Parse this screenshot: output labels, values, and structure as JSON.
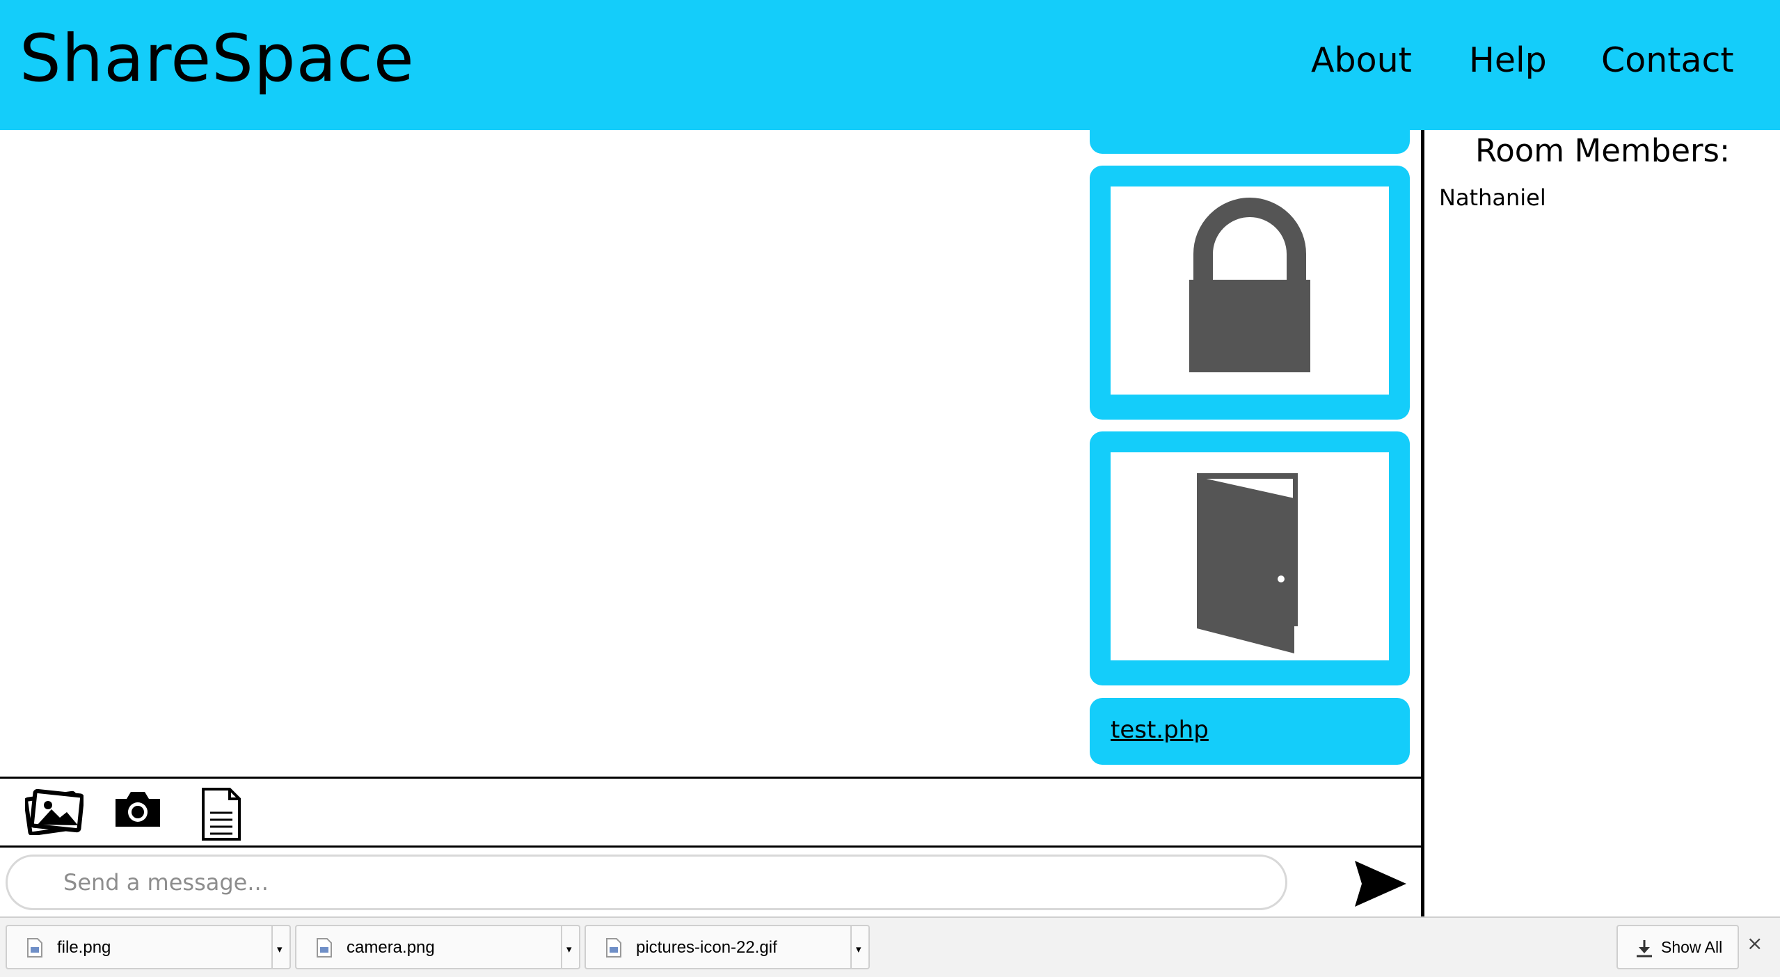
{
  "header": {
    "brand": "ShareSpace",
    "nav": [
      {
        "label": "About"
      },
      {
        "label": "Help"
      },
      {
        "label": "Contact"
      }
    ],
    "color": "#14cdfa"
  },
  "chat": {
    "messages": [
      {
        "type": "image",
        "icon": "lock-icon"
      },
      {
        "type": "image",
        "icon": "door-icon"
      },
      {
        "type": "file",
        "label": "test.php"
      }
    ]
  },
  "members": {
    "title": "Room Members:",
    "list": [
      "Nathaniel"
    ]
  },
  "toolbar": {
    "icons": [
      "pictures-icon",
      "camera-icon",
      "file-icon"
    ]
  },
  "composer": {
    "placeholder": "Send a message...",
    "send_icon": "send-arrow-icon"
  },
  "downloads": {
    "items": [
      {
        "name": "file.png"
      },
      {
        "name": "camera.png"
      },
      {
        "name": "pictures-icon-22.gif"
      }
    ],
    "show_all": "Show All",
    "close": "×"
  }
}
